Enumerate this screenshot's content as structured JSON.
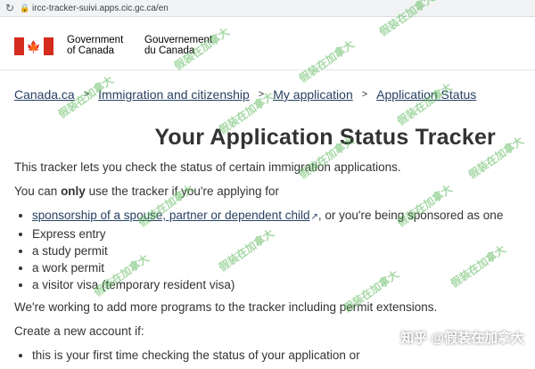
{
  "browser": {
    "url": "ircc-tracker-suivi.apps.cic.gc.ca/en"
  },
  "header": {
    "government_en_line1": "Government",
    "government_en_line2": "of Canada",
    "government_fr_line1": "Gouvernement",
    "government_fr_line2": "du Canada"
  },
  "breadcrumb": [
    "Canada.ca",
    "Immigration and citizenship",
    "My application",
    "Application Status"
  ],
  "title": "Your Application Status Tracker",
  "intro": "This tracker lets you check the status of certain immigration applications.",
  "only_prefix": "You can ",
  "only_bold": "only",
  "only_suffix": " use the tracker if you're applying for",
  "apply_list": {
    "sponsorship_link": "sponsorship of a spouse, partner or dependent child",
    "sponsorship_suffix": ", or you're being sponsored as one",
    "items": [
      "Express entry",
      "a study permit",
      "a work permit",
      "a visitor visa (temporary resident visa)"
    ]
  },
  "programs_note": "We're working to add more programs to the tracker including permit extensions.",
  "create_account": "Create a new account if:",
  "create_list": [
    "this is your first time checking the status of your application or"
  ],
  "overlay": {
    "source": "知乎 @假装在加拿大",
    "watermark": "假装在加拿大"
  },
  "colors": {
    "flag_red": "#d52b1e",
    "link": "#284162",
    "watermark": "#5cb85c"
  }
}
